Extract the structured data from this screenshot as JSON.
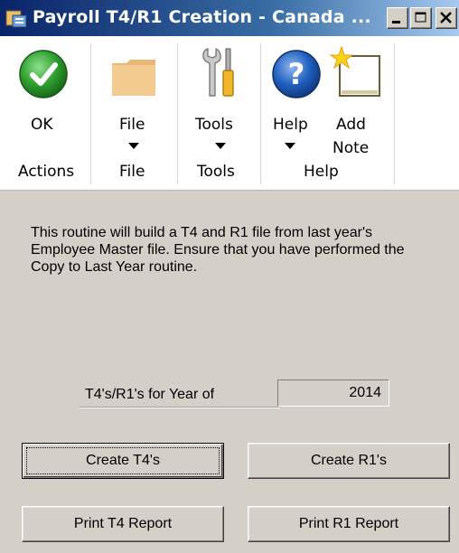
{
  "window": {
    "title": "Payroll T4/R1 Creation - Canada ..."
  },
  "ribbon": {
    "items": [
      {
        "label": "OK",
        "icon": "check-circle-icon"
      },
      {
        "label": "File",
        "icon": "folder-icon"
      },
      {
        "label": "Tools",
        "icon": "tools-icon"
      },
      {
        "label": "Help",
        "icon": "help-icon"
      },
      {
        "label": "Add\nNote",
        "icon": "add-note-icon"
      }
    ],
    "add_note_line1": "Add",
    "add_note_line2": "Note",
    "groups": [
      "Actions",
      "File",
      "Tools",
      "Help"
    ]
  },
  "main": {
    "description": "This routine will build a T4 and R1 file from last year's Employee Master file. Ensure that you have performed the Copy to Last Year routine.",
    "year_label": "T4's/R1's for Year of",
    "year_value": "2014",
    "buttons": {
      "create_t4": "Create T4's",
      "create_r1": "Create R1's",
      "print_t4": "Print T4 Report",
      "print_r1": "Print R1 Report"
    }
  },
  "colors": {
    "titlebar_start": "#0a246a",
    "titlebar_end": "#a6caf0",
    "ok_green": "#2e9e2e",
    "help_blue": "#1f5fbf",
    "folder_tan": "#f0c78a",
    "window_face": "#d4d0c8"
  }
}
